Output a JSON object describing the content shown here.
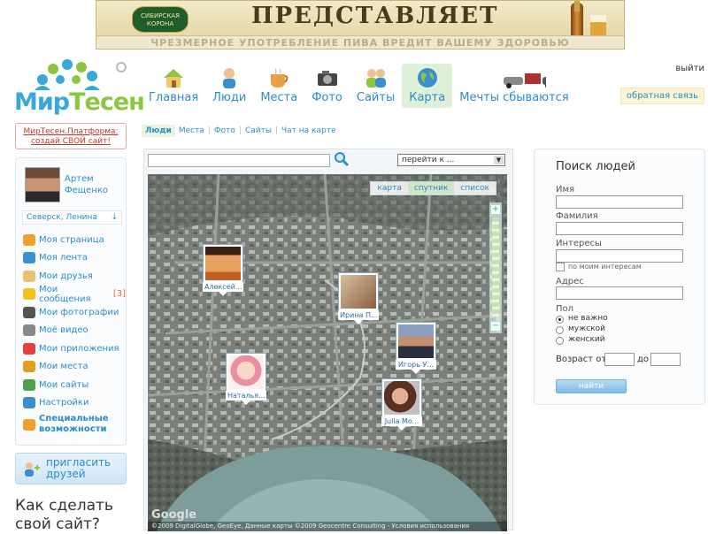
{
  "banner": {
    "brand": "СИБИРСКАЯ КОРОНА",
    "title": "ПРЕДСТАВЛЯЕТ",
    "warning": "ЧРЕЗМЕРНОЕ УПОТРЕБЛЕНИЕ ПИВА ВРЕДИТ ВАШЕМУ ЗДОРОВЬЮ"
  },
  "logo": {
    "part1": "Мир",
    "part2": "Тесен"
  },
  "nav": [
    {
      "label": "Главная",
      "icon": "house-icon"
    },
    {
      "label": "Люди",
      "icon": "person-icon"
    },
    {
      "label": "Места",
      "icon": "cup-icon"
    },
    {
      "label": "Фото",
      "icon": "camera-icon"
    },
    {
      "label": "Сайты",
      "icon": "people-icon"
    },
    {
      "label": "Карта",
      "icon": "globe-icon",
      "active": true
    },
    {
      "label": "Мечты сбываются",
      "icon": "cars-icon"
    }
  ],
  "header_links": {
    "exit": "выйти",
    "feedback": "обратная связь"
  },
  "promo": {
    "line1": "МирТесен.Платформа:",
    "line2": "создай СВОЙ сайт!"
  },
  "user": {
    "first": "Артем",
    "last": "Фещенко",
    "city": "Северск, Ленина"
  },
  "menu": [
    {
      "label": "Моя страница",
      "color": "#f0a030"
    },
    {
      "label": "Моя лента",
      "color": "#3a8fd0"
    },
    {
      "label": "Мои друзья",
      "color": "#e8c070"
    },
    {
      "label": "Мои сообщения",
      "count": "[3]",
      "color": "#f2c020"
    },
    {
      "label": "Мои фотографии",
      "color": "#555555"
    },
    {
      "label": "Моё видео",
      "color": "#888888"
    },
    {
      "label": "Мои приложения",
      "color": "#e04040"
    },
    {
      "label": "Мои места",
      "color": "#e0a020"
    },
    {
      "label": "Мои сайты",
      "color": "#50a050"
    },
    {
      "label": "Настройки",
      "color": "#3a8fd0"
    },
    {
      "label": "Специальные возможности",
      "color": "#f0a030",
      "special": true
    }
  ],
  "invite": {
    "line1": "пригласить",
    "line2": "друзей"
  },
  "howto": {
    "line1": "Как сделать",
    "line2": "свой сайт?"
  },
  "subtabs": [
    {
      "label": "Люди",
      "active": true
    },
    {
      "label": "Места"
    },
    {
      "label": "Фото"
    },
    {
      "label": "Сайты"
    },
    {
      "label": "Чат на карте"
    }
  ],
  "map": {
    "search_value": "",
    "goto_label": "перейти к ...",
    "types": [
      {
        "label": "карта"
      },
      {
        "label": "спутник",
        "active": true
      },
      {
        "label": "список"
      }
    ],
    "pins": [
      {
        "name": "Алексей...",
        "color": "#c87030"
      },
      {
        "name": "Ирина П...",
        "color": "#a07850"
      },
      {
        "name": "Игорь У...",
        "color": "#3a4a60"
      },
      {
        "name": "Наталья...",
        "color": "#e0a8a0"
      },
      {
        "name": "Julia Mo...",
        "color": "#7a5040"
      }
    ],
    "google": "Google",
    "copyright": "©2009 DigitalGlobe, GeoEye, Данные карты ©2009 Geocentre Consulting - Условия использования"
  },
  "people_search": {
    "title": "Поиск людей",
    "name_label": "Имя",
    "surname_label": "Фамилия",
    "interests_label": "Интересы",
    "my_interests_label": "по моим интересам",
    "address_label": "Адрес",
    "gender_label": "Пол",
    "gender_options": [
      "не важно",
      "мужской",
      "женский"
    ],
    "age_from_label": "Возраст от",
    "age_to_label": "до",
    "submit_label": "найти"
  }
}
